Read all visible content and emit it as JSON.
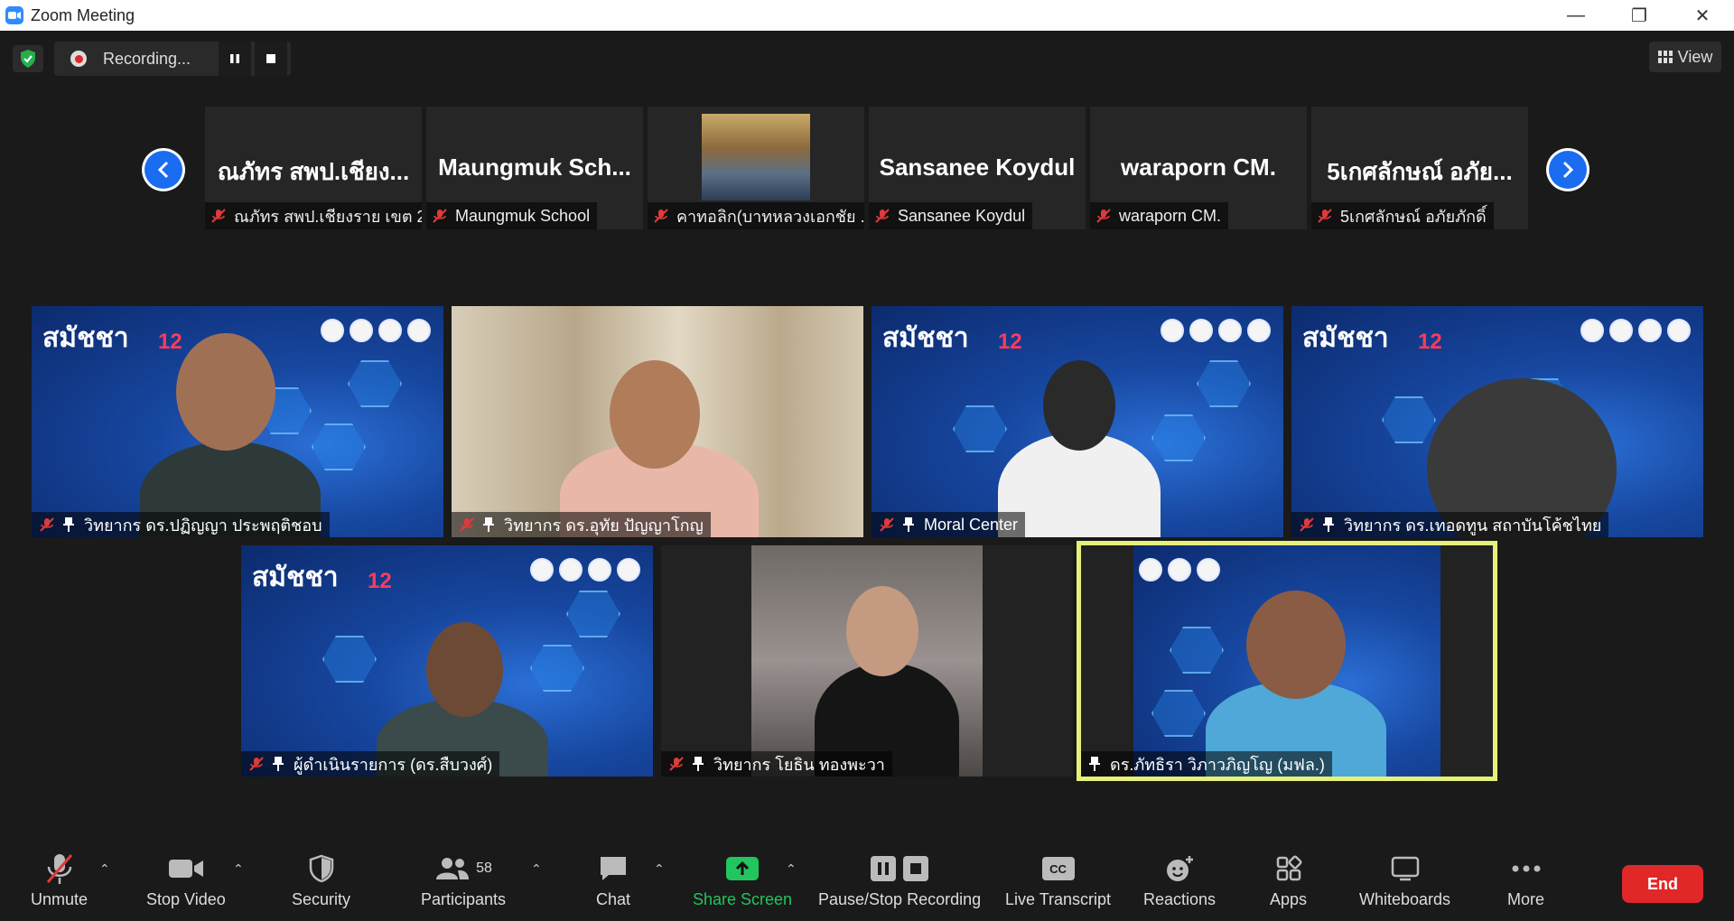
{
  "window": {
    "title": "Zoom Meeting"
  },
  "recording": {
    "status": "Recording..."
  },
  "view_button": {
    "label": "View"
  },
  "thumbnails": [
    {
      "display": "ณภัทร สพป.เชียง...",
      "name": "ณภัทร สพป.เชียงราย เขต 2"
    },
    {
      "display": "Maungmuk Sch...",
      "name": "Maungmuk School"
    },
    {
      "display": "",
      "name": "คาทอลิก(บาทหลวงเอกชัย ..."
    },
    {
      "display": "Sansanee Koydul",
      "name": "Sansanee Koydul"
    },
    {
      "display": "waraporn CM.",
      "name": "waraporn CM."
    },
    {
      "display": "5เกศลักษณ์ อภัย...",
      "name": "5เกศลักษณ์ อภัยภักดิ์"
    }
  ],
  "gallery": [
    {
      "name": "วิทยากร ดร.ปฏิญญา ประพฤติชอบ"
    },
    {
      "name": "วิทยากร ดร.อุทัย  ปัญญาโกญ"
    },
    {
      "name": "Moral Center"
    },
    {
      "name": "วิทยากร ดร.เทอดทูน สถาบันโค้ชไทย"
    },
    {
      "name": "ผู้ดำเนินรายการ (ดร.สืบวงศ์)"
    },
    {
      "name": "วิทยากร โยธิน ทองพะวา"
    },
    {
      "name": "ดร.ภัทธิรา  วิภาวภิญโญ (มฟล.)"
    }
  ],
  "backdrop": {
    "logo": "สมัชชา",
    "edition": "12"
  },
  "toolbar": {
    "unmute": "Unmute",
    "stop_video": "Stop Video",
    "security": "Security",
    "participants": "Participants",
    "participant_count": "58",
    "chat": "Chat",
    "share_screen": "Share Screen",
    "pause_stop_recording": "Pause/Stop Recording",
    "live_transcript": "Live Transcript",
    "cc": "CC",
    "reactions": "Reactions",
    "apps": "Apps",
    "whiteboards": "Whiteboards",
    "more": "More",
    "end": "End"
  },
  "colors": {
    "accent": "#2d8cff",
    "end": "#e02828",
    "share": "#22c55e",
    "active_speaker": "#e6f07a"
  }
}
